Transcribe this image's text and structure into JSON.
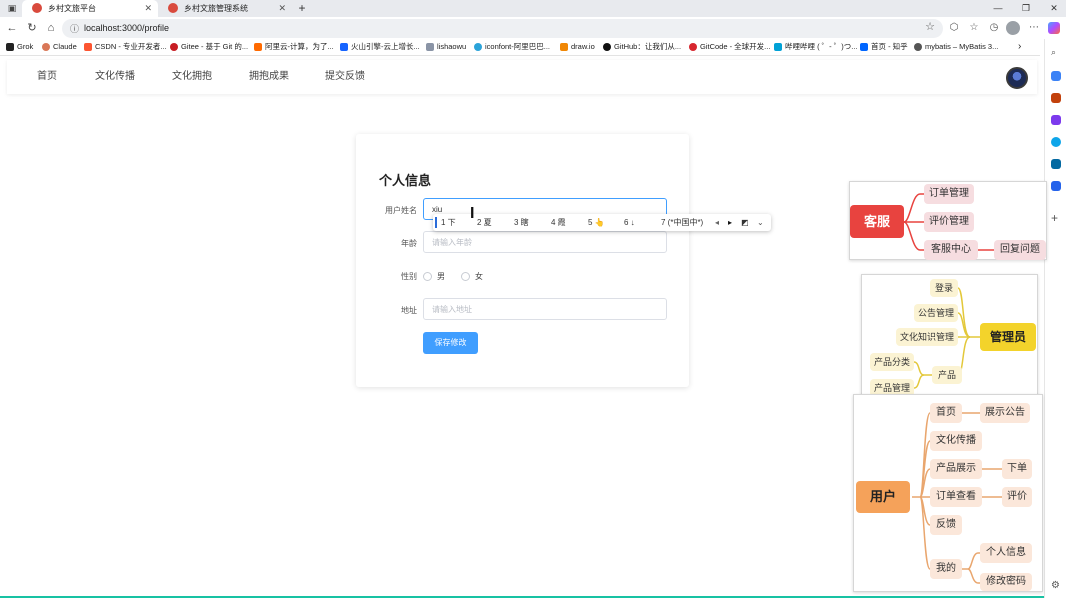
{
  "browser": {
    "tabs": [
      {
        "title": "乡村文旅平台",
        "active": true
      },
      {
        "title": "乡村文旅管理系统",
        "active": false
      }
    ],
    "new_tab": "+",
    "url": "localhost:3000/profile",
    "bookmarks": [
      "Grok",
      "Claude",
      "CSDN - 专业开发者...",
      "Gitee - 基于 Git 的...",
      "阿里云-计算，为了...",
      "火山引擎-云上增长...",
      "lishaowu",
      "iconfont-阿里巴巴...",
      "draw.io",
      "GitHub：让我们从...",
      "GitCode - 全球开发...",
      "哔哩哔哩 ( ゜- ゜)つ...",
      "首页 - 知乎",
      "mybatis – MyBatis 3..."
    ]
  },
  "nav": {
    "items": [
      "首页",
      "文化传播",
      "文化拥抱",
      "拥抱成果",
      "提交反馈"
    ]
  },
  "profile": {
    "title": "个人信息",
    "username_label": "用户姓名",
    "username_value": "xiu",
    "age_label": "年龄",
    "age_placeholder": "请输入年龄",
    "gender_label": "性别",
    "gender_male": "男",
    "gender_female": "女",
    "address_label": "地址",
    "address_placeholder": "请输入地址",
    "save_label": "保存修改"
  },
  "ime": {
    "candidates": [
      "1 下",
      "2 夏",
      "3 瞎",
      "4 霞",
      "5 👆",
      "6 ↓",
      "7 (*中国中*)"
    ]
  },
  "mindmaps": {
    "service": {
      "root": "客服",
      "children": [
        "订单管理",
        "评价管理",
        "客服中心"
      ],
      "grandchild": "回复问题"
    },
    "admin": {
      "root": "管理员",
      "children": [
        "登录",
        "公告管理",
        "文化知识管理",
        "产品"
      ],
      "product_children": [
        "产品分类",
        "产品管理"
      ]
    },
    "user": {
      "root": "用户",
      "children": [
        "首页",
        "文化传播",
        "产品展示",
        "订单查看",
        "反馈",
        "我的"
      ],
      "home_child": "展示公告",
      "product_child": "下单",
      "order_child": "评价",
      "mine_children": [
        "个人信息",
        "修改密码"
      ]
    }
  },
  "colors": {
    "primary": "#409eff",
    "service_root": "#e8433f",
    "admin_root": "#f3d32b",
    "user_root": "#f5a25a"
  }
}
